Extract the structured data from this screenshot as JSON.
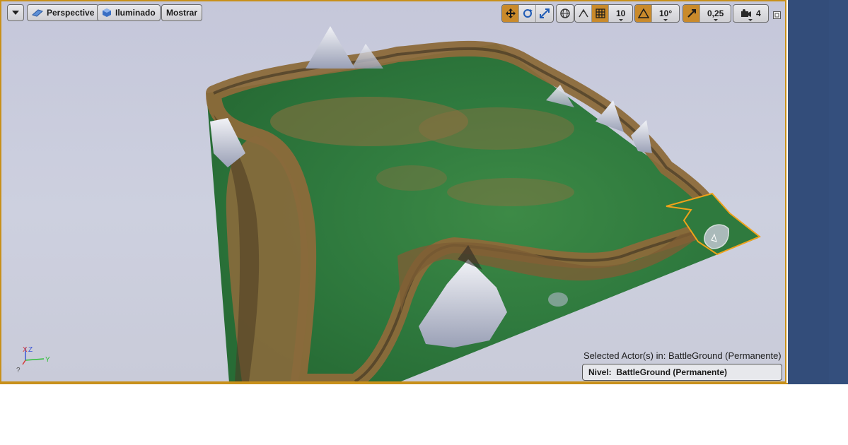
{
  "toolbar": {
    "menu_label": "",
    "perspective_label": "Perspective",
    "lit_label": "Iluminado",
    "show_label": "Mostrar",
    "grid_snap_value": "10",
    "rotation_snap_value": "10°",
    "scale_snap_value": "0,25",
    "camera_speed_value": "4"
  },
  "status": {
    "selected_actors_text": "Selected Actor(s) in:  BattleGround (Permanente)",
    "level_label": "Nivel:",
    "level_value": "BattleGround (Permanente)"
  },
  "axis": {
    "x_label": "X",
    "y_label": "Y",
    "z_label": "Z"
  },
  "colors": {
    "accent": "#c98a2b",
    "selection_border": "#c8901a",
    "panel_blue": "#334d7a",
    "terrain_green": "#2f7a3e",
    "terrain_brown": "#8a6a3c"
  }
}
